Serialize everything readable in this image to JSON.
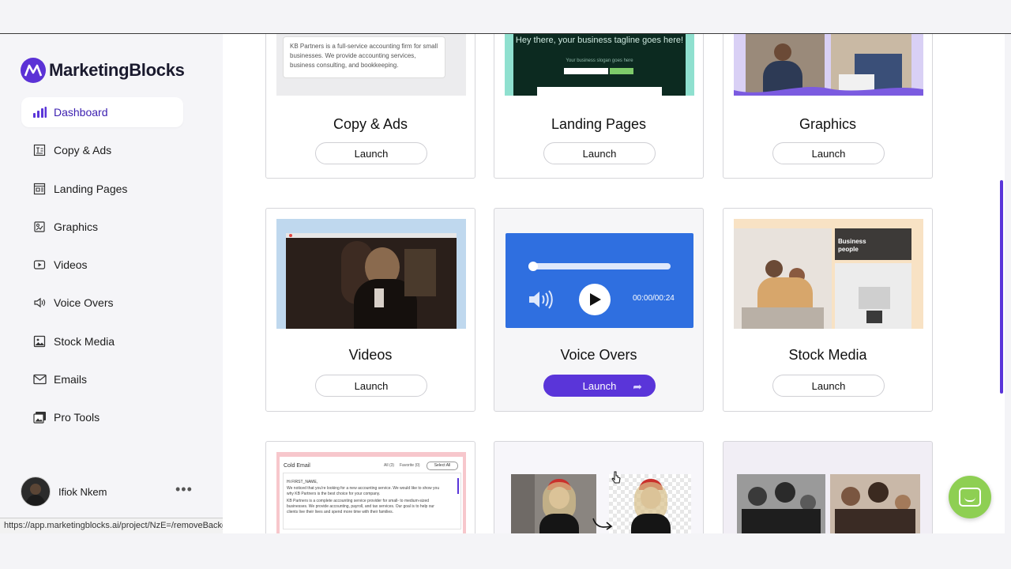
{
  "app": {
    "brand_prefix": "Marketing",
    "brand_suffix": "Blocks",
    "accent_color": "#5a35d9"
  },
  "sidebar": {
    "items": [
      {
        "label": "Dashboard",
        "icon": "bar-chart-icon"
      },
      {
        "label": "Copy & Ads",
        "icon": "text-document-icon"
      },
      {
        "label": "Landing Pages",
        "icon": "webpage-icon"
      },
      {
        "label": "Graphics",
        "icon": "palette-icon"
      },
      {
        "label": "Videos",
        "icon": "video-play-icon"
      },
      {
        "label": "Voice Overs",
        "icon": "speaker-icon"
      },
      {
        "label": "Stock Media",
        "icon": "image-icon"
      },
      {
        "label": "Emails",
        "icon": "envelope-icon"
      },
      {
        "label": "Pro Tools",
        "icon": "photos-icon"
      }
    ]
  },
  "user": {
    "name": "Ifiok Nkem",
    "more_icon": "ellipsis-icon"
  },
  "status_bar": {
    "url": "https://app.marketingblocks.ai/project/NzE=/removeBackground"
  },
  "cards": {
    "copy_ads": {
      "title": "Copy & Ads",
      "launch": "Launch",
      "preview_text": "KB Partners is a full-service accounting firm for small businesses. We provide accounting services, business consulting, and bookkeeping."
    },
    "landing_pages": {
      "title": "Landing Pages",
      "launch": "Launch",
      "preview_headline": "Hey there, your business tagline goes here!",
      "preview_sub": "Your business slogan goes here"
    },
    "graphics": {
      "title": "Graphics",
      "launch": "Launch"
    },
    "videos": {
      "title": "Videos",
      "launch": "Launch"
    },
    "voice_overs": {
      "title": "Voice Overs",
      "launch": "Launch",
      "time": "00:00/00:24"
    },
    "stock_media": {
      "title": "Stock Media",
      "launch": "Launch",
      "tag": "Business people"
    },
    "emails_preview": {
      "heading": "Cold Email",
      "tab_all": "All",
      "tab_all_count": "(3)",
      "tab_fav": "Favorite",
      "tab_fav_count": "(0)",
      "select_all": "Select All",
      "greeting": "Hi FIRST_NAME,",
      "body1": "We noticed that you're looking for a new accounting service. We would like to show you why KB Partners is the best choice for your company.",
      "body2": "KB Partners is a complete accounting service provider for small- to medium-sized businesses. We provide accounting, payroll, and tax services. Our goal is to help our clients live their lives and spend more time with their families."
    }
  }
}
